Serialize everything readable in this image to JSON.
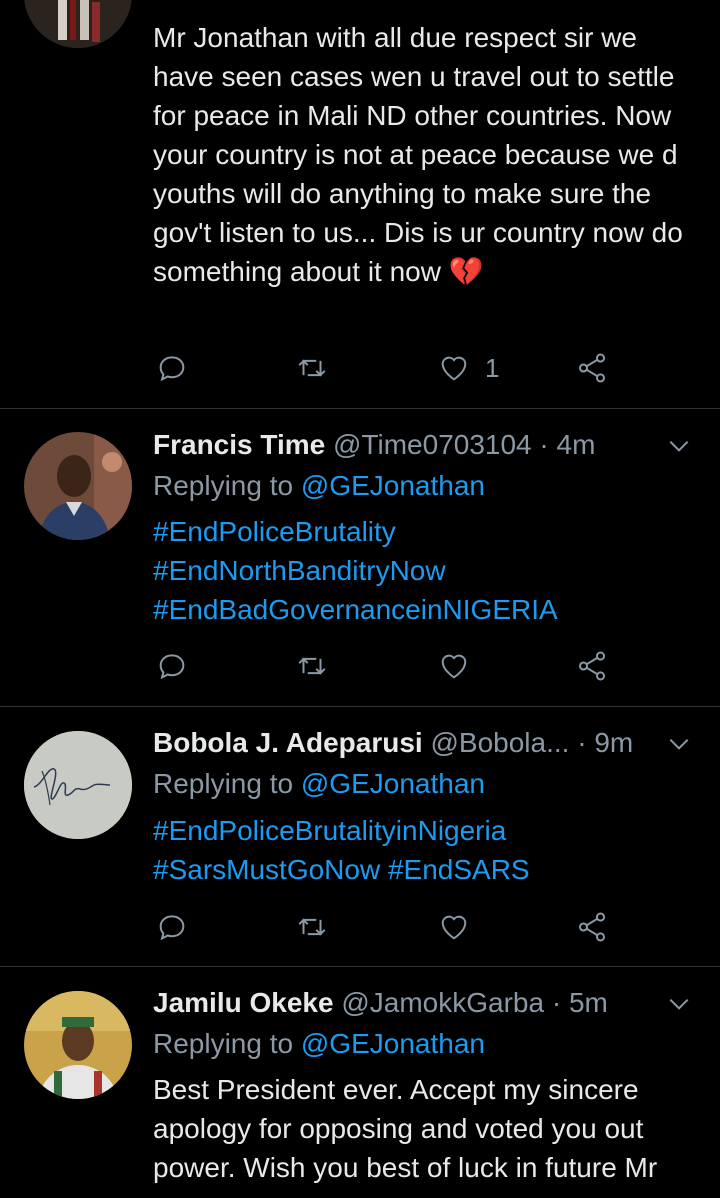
{
  "tweets": [
    {
      "body": "Mr Jonathan with all due respect sir we have seen cases wen u travel out to settle for peace in Mali ND other countries. Now your country is not at peace because we d youths will do anything to make sure the gov't listen to us... Dis is ur country now do something about it now",
      "emoji": "💔",
      "like_count": "1"
    },
    {
      "name": "Francis Time",
      "handle": "@Time0703104",
      "time": "4m",
      "replying_prefix": "Replying to",
      "replying_to": "@GEJonathan",
      "hashtags": [
        "#EndPoliceBrutality",
        "#EndNorthBanditryNow",
        "#EndBadGovernanceinNIGERIA"
      ]
    },
    {
      "name": "Bobola J. Adeparusi",
      "handle": "@Bobola...",
      "time": "9m",
      "replying_prefix": "Replying to",
      "replying_to": "@GEJonathan",
      "hashtags": [
        "#EndPoliceBrutalityinNigeria",
        "#SarsMustGoNow",
        "#EndSARS"
      ]
    },
    {
      "name": "Jamilu Okeke",
      "handle": "@JamokkGarba",
      "time": "5m",
      "replying_prefix": "Replying to",
      "replying_to": "@GEJonathan",
      "body": "Best President ever. Accept my sincere apology for opposing and voted you out power. Wish you best of luck in future Mr"
    }
  ],
  "separator": "·",
  "icons": {
    "reply": "reply-icon",
    "retweet": "retweet-icon",
    "like": "heart-icon",
    "share": "share-icon",
    "menu": "chevron-down-icon"
  },
  "colors": {
    "link": "#1d9bf0",
    "muted": "#8b98a5",
    "background": "#000000"
  }
}
